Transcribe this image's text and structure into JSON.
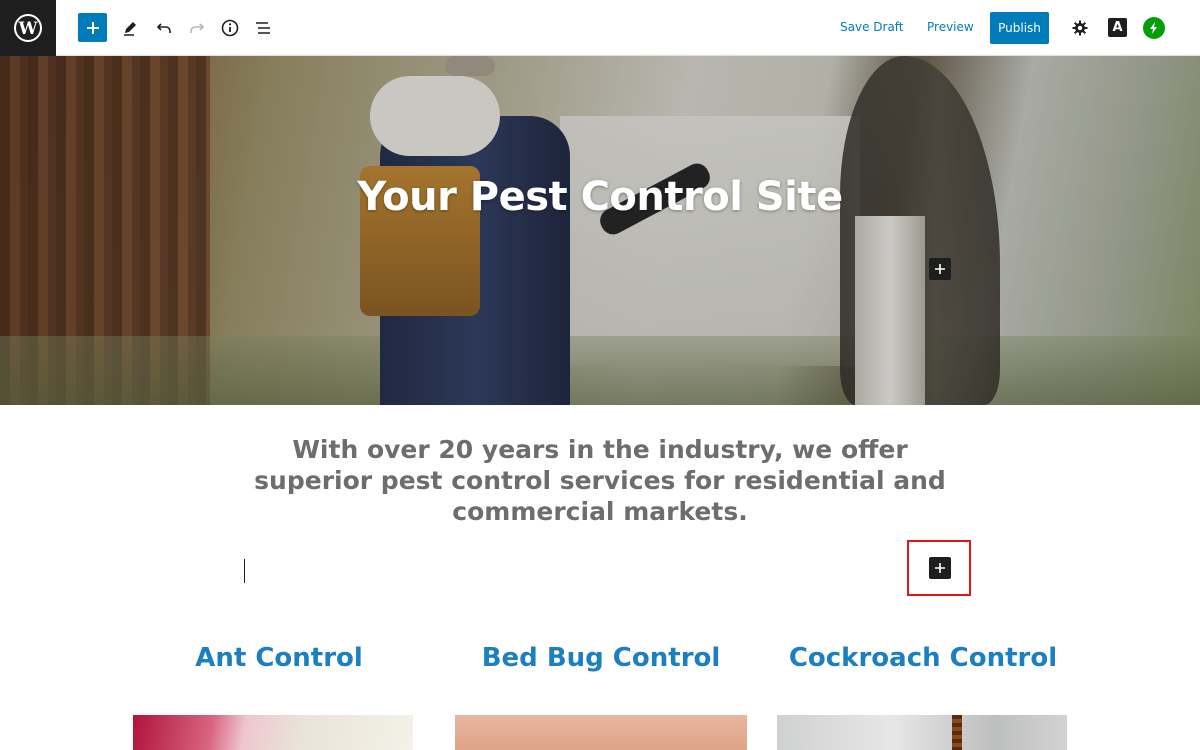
{
  "toolbar": {
    "save_draft_label": "Save Draft",
    "preview_label": "Preview",
    "publish_label": "Publish",
    "a_icon_letter": "A"
  },
  "hero": {
    "title": "Your Pest Control Site"
  },
  "intro": {
    "text": "With over 20 years in the industry, we offer superior pest control services for residential and commercial markets."
  },
  "services": [
    {
      "title": "Ant Control"
    },
    {
      "title": "Bed Bug Control"
    },
    {
      "title": "Cockroach Control"
    }
  ],
  "colors": {
    "accent": "#007cba",
    "heading_blue": "#1b7fc0",
    "highlight_red": "#e01a1a",
    "jetpack_green": "#069e08"
  }
}
